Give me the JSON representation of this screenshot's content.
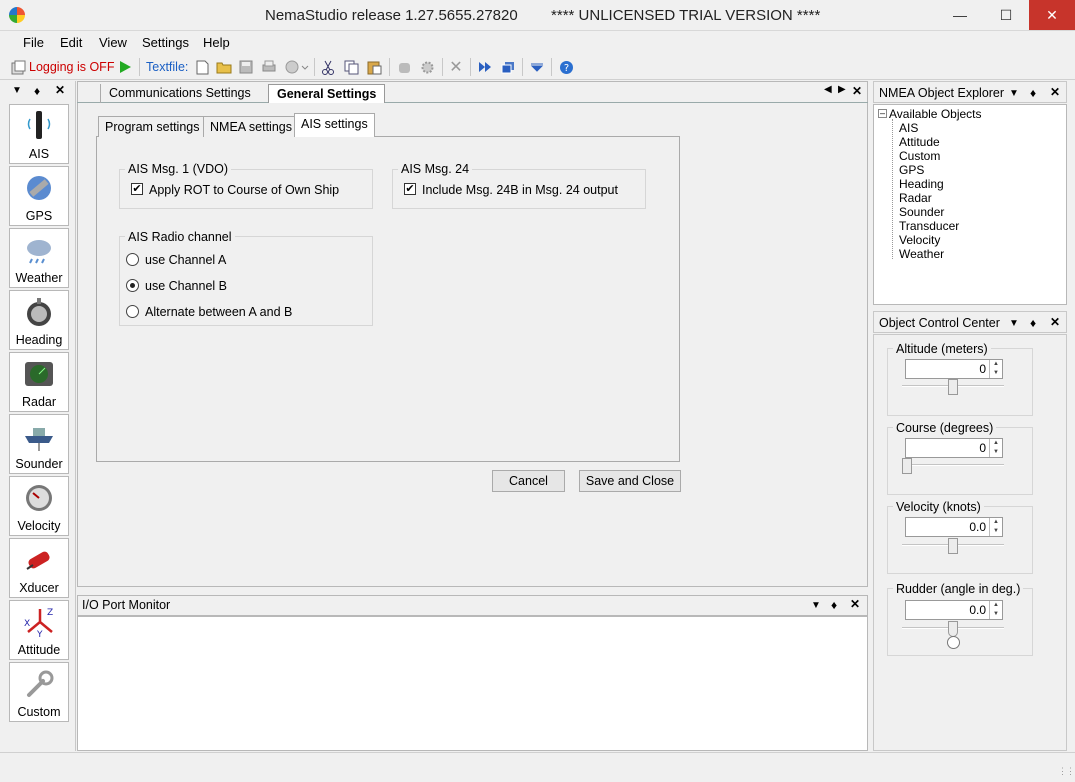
{
  "window": {
    "title": "NemaStudio release 1.27.5655.27820        **** UNLICENSED TRIAL VERSION ****"
  },
  "menu": [
    "File",
    "Edit",
    "View",
    "Settings",
    "Help"
  ],
  "toolbar": {
    "logging": "Logging is OFF",
    "textfile": "Textfile:"
  },
  "left_tools": [
    "AIS",
    "GPS",
    "Weather",
    "Heading",
    "Radar",
    "Sounder",
    "Velocity",
    "Xducer",
    "Attitude",
    "Custom"
  ],
  "doc_tabs": {
    "comm": "Communications Settings",
    "general": "General Settings"
  },
  "sub_tabs": {
    "program": "Program settings",
    "nmea": "NMEA settings",
    "ais": "AIS settings"
  },
  "ais": {
    "msg1_title": "AIS Msg. 1  (VDO)",
    "msg1_check": "Apply ROT to Course of Own Ship",
    "msg24_title": "AIS Msg. 24",
    "msg24_check": "Include Msg. 24B in Msg. 24 output",
    "radio_title": "AIS Radio channel",
    "radio_a": "use Channel A",
    "radio_b": "use Channel B",
    "radio_alt": "Alternate between  A and B",
    "selected_channel": "use Channel B"
  },
  "buttons": {
    "cancel": "Cancel",
    "save": "Save and Close"
  },
  "io_monitor": {
    "title": "I/O Port Monitor"
  },
  "explorer": {
    "title": "NMEA Object Explorer",
    "root": "Available Objects",
    "items": [
      "AIS",
      "Attitude",
      "Custom",
      "GPS",
      "Heading",
      "Radar",
      "Sounder",
      "Transducer",
      "Velocity",
      "Weather"
    ]
  },
  "control": {
    "title": "Object Control Center",
    "altitude": {
      "label": "Altitude (meters)",
      "value": "0",
      "slider_level": 0.5
    },
    "course": {
      "label": "Course (degrees)",
      "value": "0",
      "slider_level": 0.0
    },
    "velocity": {
      "label": "Velocity (knots)",
      "value": "0.0",
      "slider_level": 0.5
    },
    "rudder": {
      "label": "Rudder (angle in deg.)",
      "value": "0.0",
      "slider_level": 0.5
    }
  },
  "icons": {
    "pin": "pin-icon",
    "close": "close-icon",
    "dropdown": "dropdown-icon"
  }
}
